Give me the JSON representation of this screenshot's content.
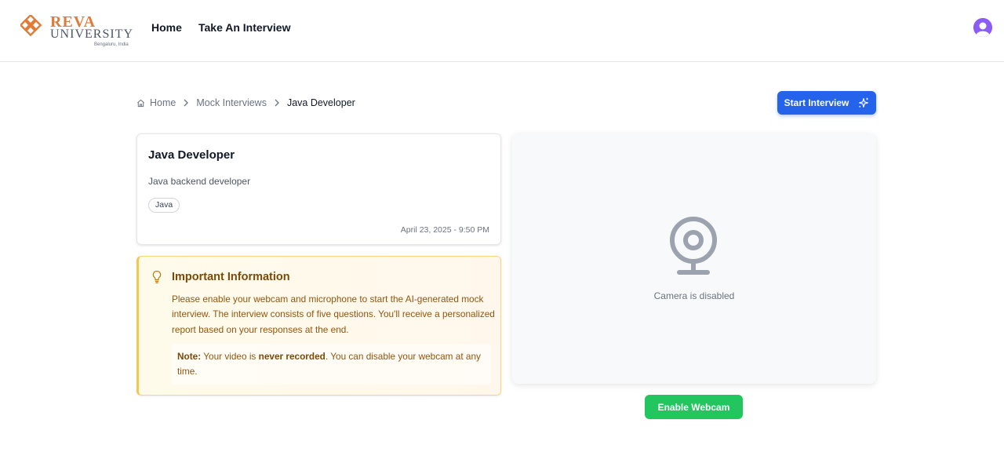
{
  "header": {
    "logo": {
      "line1": "REVA",
      "line2": "UNIVERSITY",
      "line3": "Bengaluru, India"
    },
    "nav": [
      {
        "label": "Home"
      },
      {
        "label": "Take An Interview"
      }
    ],
    "avatar_icon": "user-avatar-icon"
  },
  "breadcrumb": {
    "items": [
      {
        "label": "Home",
        "icon": "home-icon"
      },
      {
        "label": "Mock Interviews"
      },
      {
        "label": "Java Developer"
      }
    ]
  },
  "start_button": {
    "label": "Start Interview",
    "icon": "sparkles-icon"
  },
  "job": {
    "title": "Java Developer",
    "description": "Java backend developer",
    "tag": "Java",
    "date": "April 23, 2025 - 9:50 PM"
  },
  "info": {
    "icon": "lightbulb-icon",
    "title": "Important Information",
    "text": "Please enable your webcam and microphone to start the AI-generated mock interview. The interview consists of five questions. You'll receive a personalized report based on your responses at the end.",
    "note_label": "Note:",
    "note_pre": " Your video is ",
    "note_bold": "never recorded",
    "note_post": ". You can disable your webcam at any time."
  },
  "camera": {
    "icon": "webcam-icon",
    "status": "Camera is disabled"
  },
  "webcam_button": {
    "label": "Enable Webcam"
  },
  "colors": {
    "primary": "#2563eb",
    "success": "#22c55e",
    "brand_orange": "#e07b39",
    "warning_text": "#92550e",
    "avatar": "#8b5cf6"
  }
}
